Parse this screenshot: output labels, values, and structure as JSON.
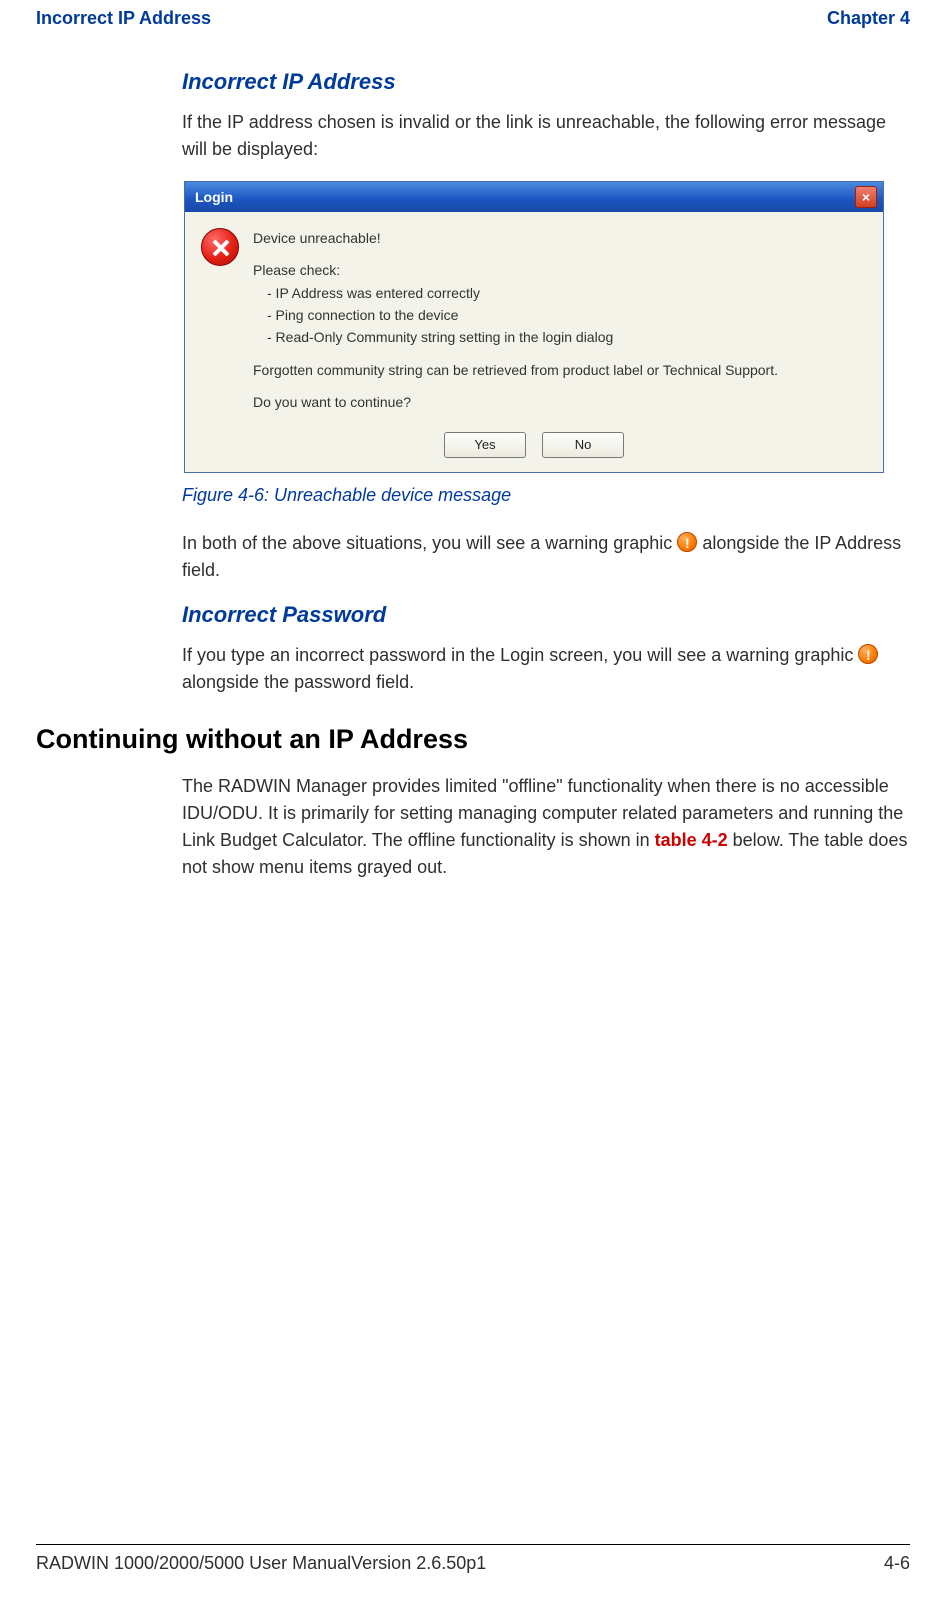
{
  "header": {
    "left": "Incorrect IP Address",
    "right": "Chapter 4"
  },
  "sections": {
    "s1_title": "Incorrect IP Address",
    "s1_para": "If the IP address chosen is invalid or the link is unreachable, the following error message will be displayed:",
    "fig_caption": "Figure 4-6: Unreachable device message",
    "s1_para2a": "In both of the above situations, you will see a warning graphic ",
    "s1_para2b": " alongside the IP Address field.",
    "s2_title": "Incorrect Password",
    "s2_para_a": "If you type an incorrect password in the Login screen, you will see a warning graphic ",
    "s2_para_b": " alongside the password field.",
    "h1": "Continuing without an IP Address",
    "s3_para_a": "The RADWIN Manager provides limited \"offline\" functionality when there is no accessible IDU/ODU. It is primarily for setting managing computer related parameters and running the Link Budget Calculator. The offline functionality is shown in ",
    "s3_tableref": "table 4-2",
    "s3_para_b": " below. The table does not show menu items grayed out."
  },
  "dialog": {
    "title": "Login",
    "main": "Device unreachable!",
    "check": "Please check:",
    "c1": "- IP Address was entered correctly",
    "c2": "- Ping connection to the device",
    "c3": "- Read-Only Community string setting in the login dialog",
    "forgot": "Forgotten community string can be retrieved from product label or Technical Support.",
    "continue": "Do you want to continue?",
    "yes": "Yes",
    "no": "No"
  },
  "footer": {
    "left": "RADWIN 1000/2000/5000 User ManualVersion  2.6.50p1",
    "right": "4-6"
  }
}
